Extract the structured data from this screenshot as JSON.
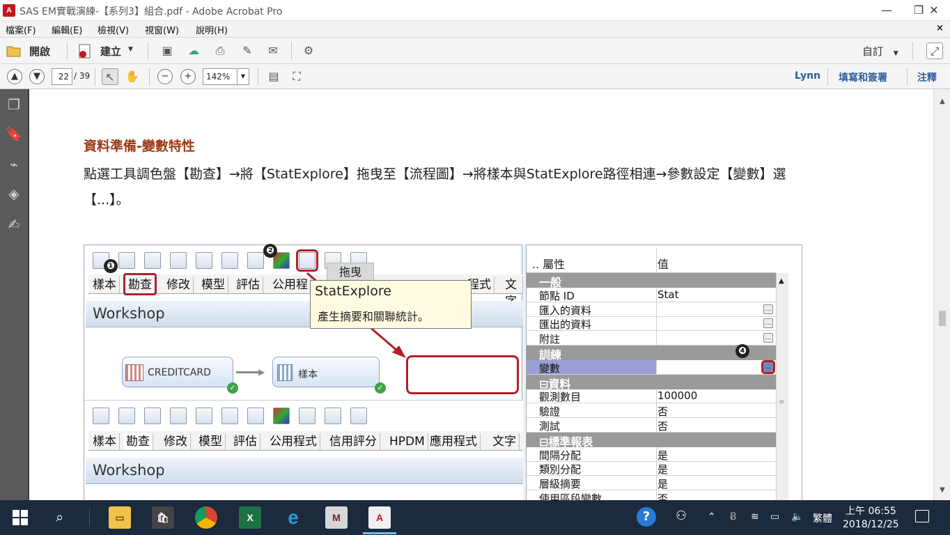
{
  "window": {
    "title": "SAS EM實戰演練-【系列3】組合.pdf - Adobe Acrobat Pro",
    "app_icon": "A",
    "minimize": "—",
    "restore": "❐",
    "close": "✕"
  },
  "menu": {
    "items": [
      "檔案(F)",
      "編輯(E)",
      "檢視(V)",
      "視窗(W)",
      "說明(H)"
    ],
    "close": "×"
  },
  "toolbar1": {
    "open_label": "開啟",
    "create_label": "建立",
    "customize_label": "自訂"
  },
  "toolbar2": {
    "page_current": "22",
    "page_total": "/ 39",
    "zoom": "142%",
    "user": "Lynn",
    "fill_sign": "填寫和簽署",
    "comment": "注釋"
  },
  "doc": {
    "heading": "資料準備-變數特性",
    "para1": "點選工具調色盤【勘查】→將【StatExplore】拖曳至【流程圖】→將樣本與StatExplore路徑相連→參數設定【變數】選",
    "para2": "【...】。"
  },
  "shot": {
    "tabs_top": [
      "樣本",
      "勘查",
      "修改",
      "模型",
      "評估",
      "公用程",
      "",
      "程式",
      "文字"
    ],
    "tabs_bottom": [
      "樣本",
      "勘查",
      "修改",
      "模型",
      "評估",
      "公用程式",
      "信用評分",
      "HPDM",
      "應用程式",
      "文字"
    ],
    "badges": [
      "❶",
      "❷",
      "❹"
    ],
    "drag_label": "拖曳",
    "tooltip_title": "StatExplore",
    "tooltip_desc": "產生摘要和關聯統計。",
    "workshop": "Workshop",
    "node1": "CREDITCARD",
    "node2": "樣本",
    "props_header": {
      "k": ".. 屬性",
      "v": "值"
    },
    "props": [
      {
        "type": "sec",
        "k": "一般"
      },
      {
        "type": "row",
        "k": "節點 ID",
        "v": "Stat"
      },
      {
        "type": "row",
        "k": "匯入的資料",
        "v": "",
        "dots": true
      },
      {
        "type": "row",
        "k": "匯出的資料",
        "v": "",
        "dots": true
      },
      {
        "type": "row",
        "k": "附註",
        "v": "",
        "dots": true
      },
      {
        "type": "sec",
        "k": "訓練"
      },
      {
        "type": "hl",
        "k": "變數",
        "v": "",
        "dots": true
      },
      {
        "type": "sec",
        "k": "⊟資料"
      },
      {
        "type": "row",
        "k": "觀測數目",
        "v": "100000"
      },
      {
        "type": "row",
        "k": "驗證",
        "v": "否"
      },
      {
        "type": "row",
        "k": "測試",
        "v": "否"
      },
      {
        "type": "sec",
        "k": "⊟標準報表"
      },
      {
        "type": "row",
        "k": "間隔分配",
        "v": "是"
      },
      {
        "type": "row",
        "k": "類別分配",
        "v": "是"
      },
      {
        "type": "row",
        "k": "層級摘要",
        "v": "是"
      },
      {
        "type": "row",
        "k": "使用區段變數",
        "v": "否"
      }
    ]
  },
  "taskbar": {
    "ime": "繁體",
    "time": "上午 06:55",
    "date": "2018/12/25",
    "help": "?"
  }
}
